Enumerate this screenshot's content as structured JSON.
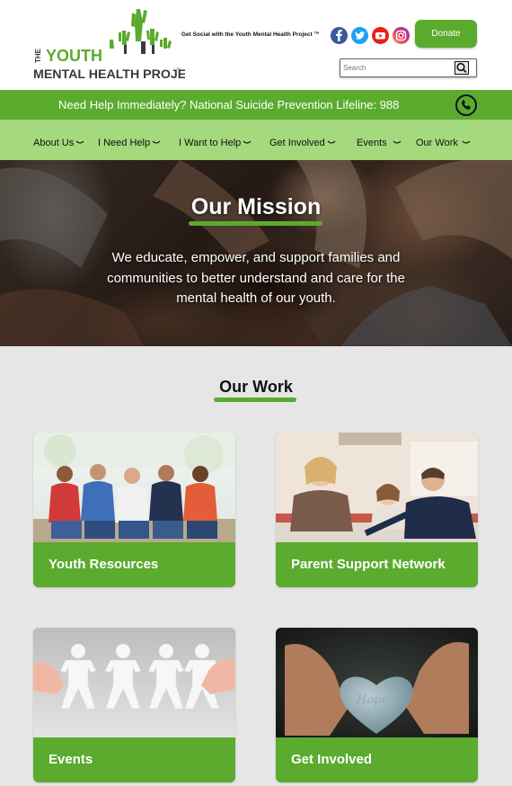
{
  "header": {
    "logo": {
      "the": "THE",
      "youth": "YOUTH",
      "line2": "MENTAL HEALTH PROJECT",
      "tm": "™"
    },
    "social_text": "Get Social with the Youth Mental Health Project ™",
    "social_icons": [
      "facebook-icon",
      "twitter-icon",
      "youtube-icon",
      "instagram-icon"
    ],
    "donate_label": "Donate",
    "search_placeholder": "Search"
  },
  "lifeline": {
    "text": "Need Help Immediately? National Suicide Prevention Lifeline: 988"
  },
  "nav": {
    "items": [
      {
        "label": "About Us"
      },
      {
        "label": "I Need Help"
      },
      {
        "label": "I Want to Help"
      },
      {
        "label": "Get Involved"
      },
      {
        "label": "Events"
      },
      {
        "label": "Our Work"
      }
    ]
  },
  "hero": {
    "title": "Our Mission",
    "text": "We educate, empower, and support families and communities to better understand and care for the mental health of our youth."
  },
  "work": {
    "title": "Our Work",
    "cards": [
      {
        "label": "Youth Resources"
      },
      {
        "label": "Parent Support Network"
      },
      {
        "label": "Events"
      },
      {
        "label": "Get Involved"
      }
    ]
  },
  "colors": {
    "brand_green": "#5aab2e",
    "nav_green": "#a5d97e",
    "page_bg": "#e6e6e6"
  }
}
